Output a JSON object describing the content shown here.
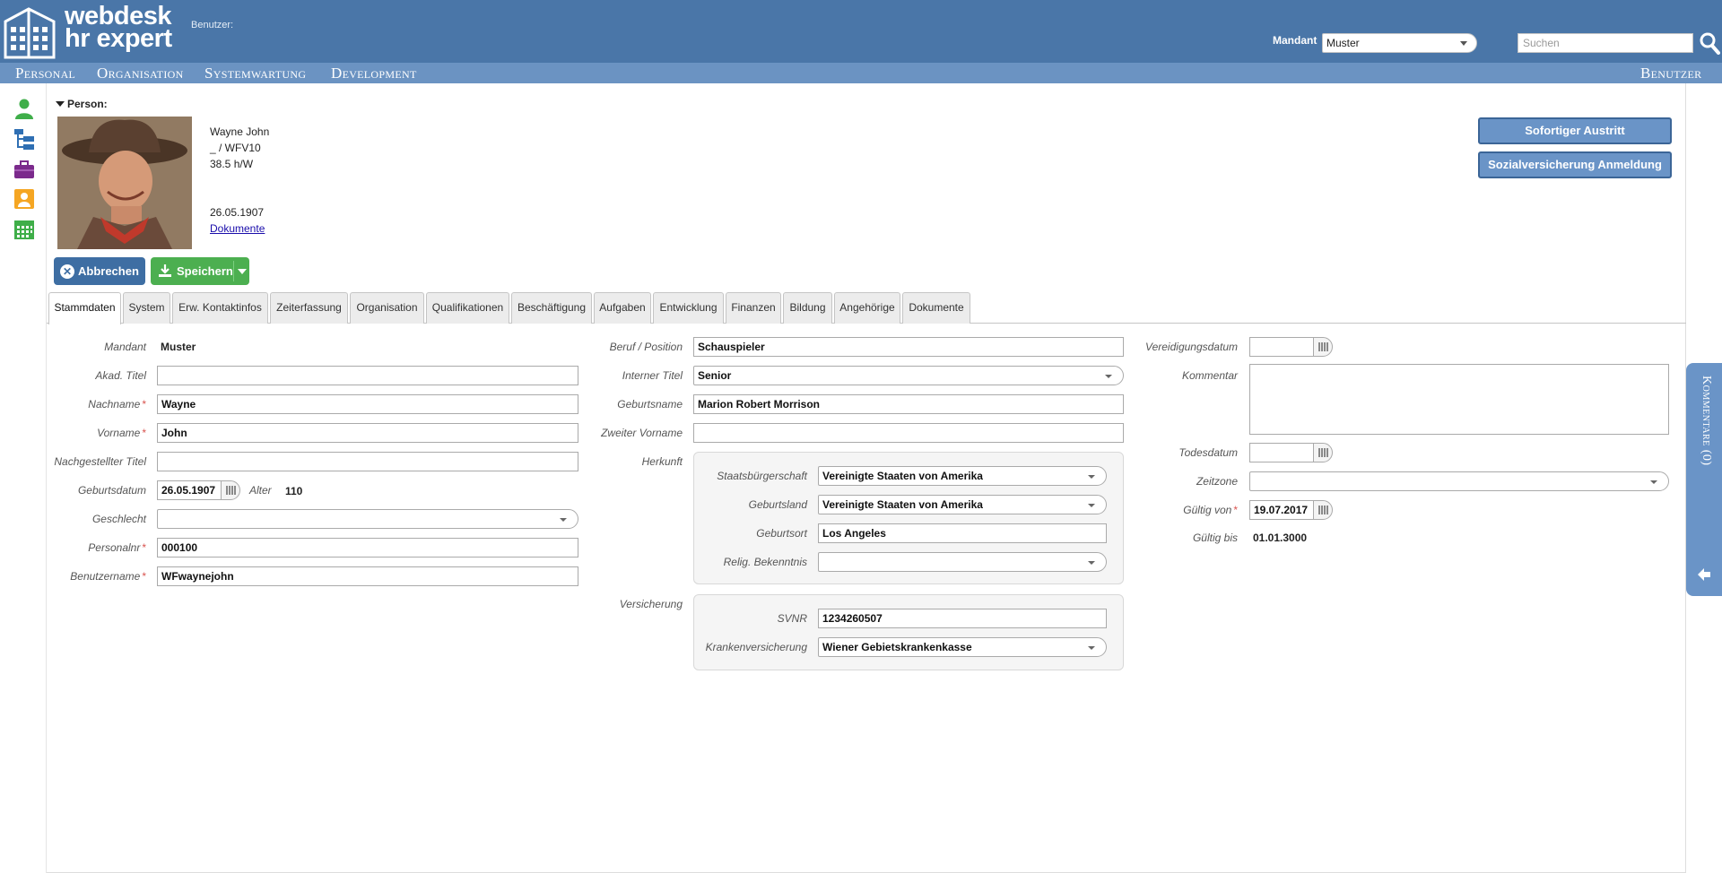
{
  "header": {
    "brand_line1": "webdesk",
    "brand_line2": "hr expert",
    "user_label": "Benutzer:",
    "mandant_label": "Mandant",
    "mandant_value": "Muster",
    "search_placeholder": "Suchen"
  },
  "nav": {
    "items": [
      "Personal",
      "Organisation",
      "Systemwartung",
      "Development"
    ],
    "right": "Benutzer"
  },
  "person": {
    "section_label": "Person:",
    "name": "Wayne John",
    "code": "_ / WFV10",
    "hours": "38.5 h/W",
    "birthdate": "26.05.1907",
    "documents_link": "Dokumente"
  },
  "actions": {
    "immediate_exit": "Sofortiger Austritt",
    "social_registration": "Sozialversicherung Anmeldung",
    "cancel": "Abbrechen",
    "save": "Speichern"
  },
  "tabs": [
    "Stammdaten",
    "System",
    "Erw. Kontaktinfos",
    "Zeiterfassung",
    "Organisation",
    "Qualifikationen",
    "Beschäftigung",
    "Aufgaben",
    "Entwicklung",
    "Finanzen",
    "Bildung",
    "Angehörige",
    "Dokumente"
  ],
  "form": {
    "col1": {
      "mandant_label": "Mandant",
      "mandant_value": "Muster",
      "title_label": "Akad. Titel",
      "title_value": "",
      "lastname_label": "Nachname",
      "lastname_value": "Wayne",
      "firstname_label": "Vorname",
      "firstname_value": "John",
      "suffix_label": "Nachgestellter Titel",
      "suffix_value": "",
      "birth_label": "Geburtsdatum",
      "birth_value": "26.05.1907",
      "age_label": "Alter",
      "age_value": "110",
      "gender_label": "Geschlecht",
      "gender_value": "",
      "persnr_label": "Personalnr",
      "persnr_value": "000100",
      "username_label": "Benutzername",
      "username_value": "WFwaynejohn"
    },
    "col2": {
      "job_label": "Beruf / Position",
      "job_value": "Schauspieler",
      "internal_title_label": "Interner Titel",
      "internal_title_value": "Senior",
      "birthname_label": "Geburtsname",
      "birthname_value": "Marion Robert Morrison",
      "second_name_label": "Zweiter Vorname",
      "second_name_value": "",
      "origin_label": "Herkunft",
      "citizenship_label": "Staatsbürgerschaft",
      "citizenship_value": "Vereinigte Staaten von Amerika",
      "birthcountry_label": "Geburtsland",
      "birthcountry_value": "Vereinigte Staaten von Amerika",
      "birthplace_label": "Geburtsort",
      "birthplace_value": "Los Angeles",
      "religion_label": "Relig. Bekenntnis",
      "religion_value": "",
      "insurance_label": "Versicherung",
      "svnr_label": "SVNR",
      "svnr_value": "1234260507",
      "health_label": "Krankenversicherung",
      "health_value": "Wiener Gebietskrankenkasse"
    },
    "col3": {
      "oath_label": "Vereidigungsdatum",
      "oath_value": "",
      "comment_label": "Kommentar",
      "comment_value": "",
      "death_label": "Todesdatum",
      "death_value": "",
      "timezone_label": "Zeitzone",
      "timezone_value": "",
      "valid_from_label": "Gültig von",
      "valid_from_value": "19.07.2017",
      "valid_to_label": "Gültig bis",
      "valid_to_value": "01.01.3000"
    }
  },
  "sidebar": {
    "comments": "Kommentare (0)"
  },
  "colors": {
    "header": "#4a76a8",
    "navbar": "#6b93c2",
    "primary_button": "#6a94c7",
    "save_button": "#4caf50",
    "required": "#d9534f"
  },
  "icons": [
    "person-icon",
    "org-tree-icon",
    "briefcase-icon",
    "contact-card-icon",
    "calendar-icon",
    "search-icon",
    "calendar-picker-icon",
    "arrow-left-icon"
  ]
}
